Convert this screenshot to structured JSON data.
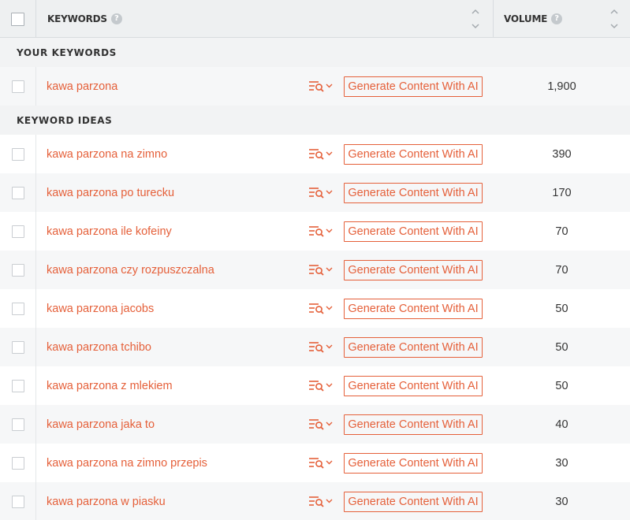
{
  "header": {
    "keywords_label": "KEYWORDS",
    "volume_label": "VOLUME",
    "help_glyph": "?",
    "icons": [
      "checkbox",
      "help-icon",
      "sort-icon"
    ]
  },
  "sections": {
    "your_keywords": "YOUR KEYWORDS",
    "keyword_ideas": "KEYWORD IDEAS"
  },
  "accent_color": "#e5603a",
  "generate_label": "Generate Content With AI",
  "your_keywords": [
    {
      "keyword": "kawa parzona",
      "volume": "1,900"
    }
  ],
  "keyword_ideas": [
    {
      "keyword": "kawa parzona na zimno",
      "volume": "390"
    },
    {
      "keyword": "kawa parzona po turecku",
      "volume": "170"
    },
    {
      "keyword": "kawa parzona ile kofeiny",
      "volume": "70"
    },
    {
      "keyword": "kawa parzona czy rozpuszczalna",
      "volume": "70"
    },
    {
      "keyword": "kawa parzona jacobs",
      "volume": "50"
    },
    {
      "keyword": "kawa parzona tchibo",
      "volume": "50"
    },
    {
      "keyword": "kawa parzona z mlekiem",
      "volume": "50"
    },
    {
      "keyword": "kawa parzona jaka to",
      "volume": "40"
    },
    {
      "keyword": "kawa parzona na zimno przepis",
      "volume": "30"
    },
    {
      "keyword": "kawa parzona w piasku",
      "volume": "30"
    }
  ]
}
